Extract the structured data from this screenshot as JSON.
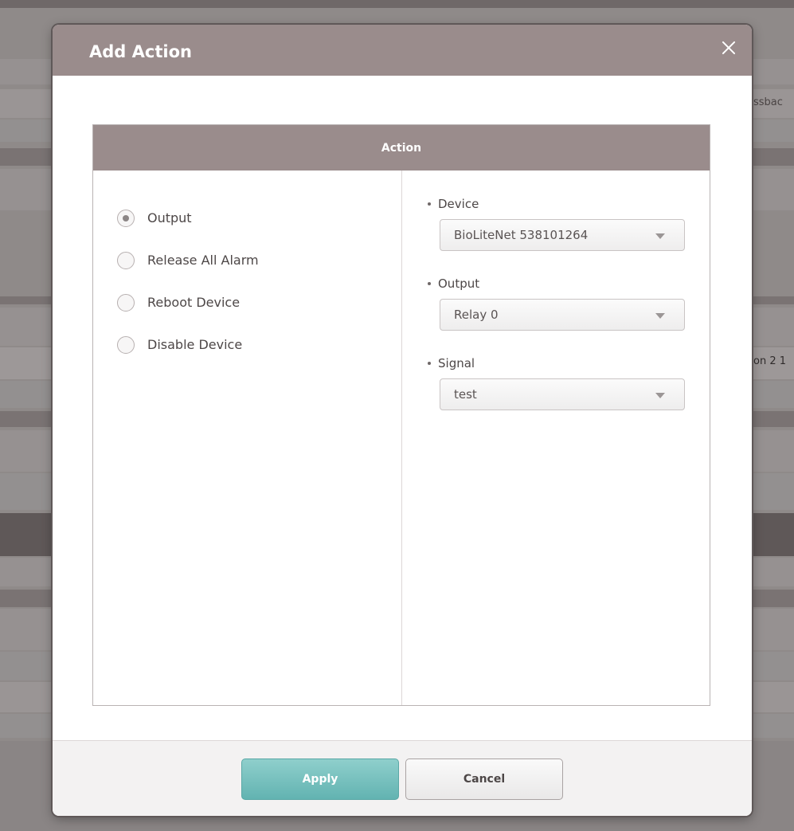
{
  "background": {
    "fragments": [
      "ssbac",
      "on 2 1"
    ]
  },
  "modal": {
    "title": "Add Action",
    "close_icon": "close-icon"
  },
  "panel": {
    "header": "Action",
    "options": [
      {
        "label": "Output",
        "checked": true
      },
      {
        "label": "Release All Alarm",
        "checked": false
      },
      {
        "label": "Reboot Device",
        "checked": false
      },
      {
        "label": "Disable Device",
        "checked": false
      }
    ],
    "fields": {
      "device": {
        "label": "Device",
        "value": "BioLiteNet 538101264"
      },
      "output": {
        "label": "Output",
        "value": "Relay 0"
      },
      "signal": {
        "label": "Signal",
        "value": "test"
      }
    }
  },
  "footer": {
    "apply_label": "Apply",
    "cancel_label": "Cancel"
  },
  "colors": {
    "header": "#9a8c8c",
    "apply": "#62b3b1",
    "backdrop": "#8f8a89"
  }
}
